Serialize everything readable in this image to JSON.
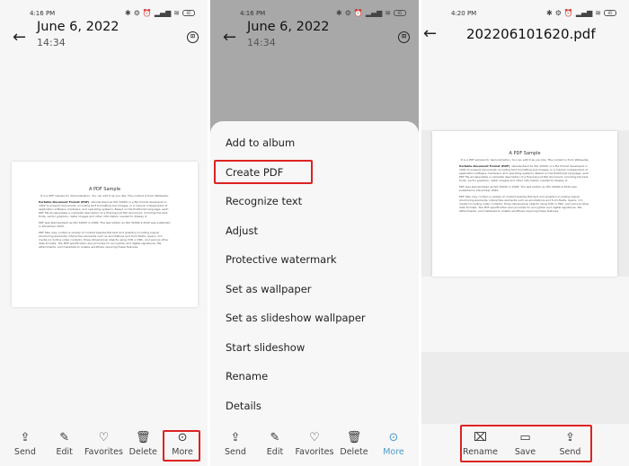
{
  "panels": [
    {
      "status": {
        "time": "4:16 PM",
        "battery": "85"
      },
      "header": {
        "title": "June 6, 2022",
        "subtitle": "14:34"
      },
      "toolbar": [
        {
          "label": "Send",
          "icon": "share-icon"
        },
        {
          "label": "Edit",
          "icon": "edit-icon"
        },
        {
          "label": "Favorites",
          "icon": "heart-icon"
        },
        {
          "label": "Delete",
          "icon": "trash-icon"
        },
        {
          "label": "More",
          "icon": "more-icon"
        }
      ]
    },
    {
      "status": {
        "time": "4:16 PM",
        "battery": "85"
      },
      "header": {
        "title": "June 6, 2022",
        "subtitle": "14:34"
      },
      "menu": [
        "Add to album",
        "Create PDF",
        "Recognize text",
        "Adjust",
        "Protective watermark",
        "Set as wallpaper",
        "Set as slideshow wallpaper",
        "Start slideshow",
        "Rename",
        "Details"
      ],
      "toolbar": [
        {
          "label": "Send",
          "icon": "share-icon"
        },
        {
          "label": "Edit",
          "icon": "edit-icon"
        },
        {
          "label": "Favorites",
          "icon": "heart-icon"
        },
        {
          "label": "Delete",
          "icon": "trash-icon"
        },
        {
          "label": "More",
          "icon": "more-icon"
        }
      ]
    },
    {
      "status": {
        "time": "4:20 PM",
        "battery": "85"
      },
      "header": {
        "title": "202206101620.pdf"
      },
      "toolbar": [
        {
          "label": "Rename",
          "icon": "rename-icon"
        },
        {
          "label": "Save",
          "icon": "save-icon"
        },
        {
          "label": "Send",
          "icon": "share-icon"
        }
      ]
    }
  ],
  "document": {
    "title": "A PDF Sample",
    "subtitle": "It is a PDF sample for demonstration. You can edit it as you like. The content is from Wikipedia.",
    "para1_bold": "Portable Document Format (PDF)",
    "para1": ", standardized as ISO 32000, is a file format developed in 1992 to present documents, including text formatting and images, in a manner independent of application software, hardware, and operating systems. Based on the PostScript language, each PDF file encapsulates a complete description of a fixed-layout flat document, including the text, fonts, vector graphics, raster images and other information needed to display it.",
    "para2": "PDF was standardized as ISO 32000 in 2008. The last edition as ISO 32000-2:2020 was published in December 2020.",
    "para3": "PDF files may contain a variety of content besides flat text and graphics including logical structuring elements, interactive elements such as annotations and form-fields, layers, rich media (including video content), three-dimensional objects using U3D or PRC, and various other data formats. The PDF specification also provides for encryption and digital signatures, file attachments, and metadata to enable workflows requiring these features."
  },
  "colors": {
    "highlight": "#dd2222",
    "active": "#4a9bc8"
  }
}
